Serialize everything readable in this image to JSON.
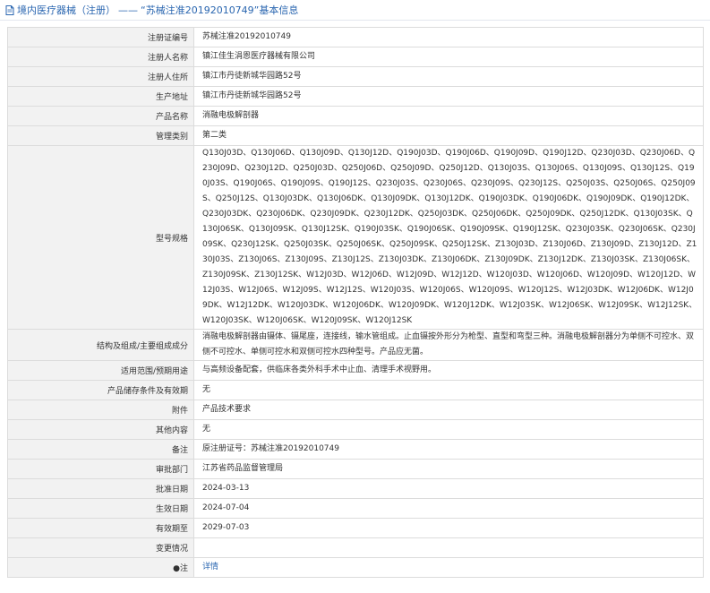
{
  "header": {
    "category": "境内医疗器械（注册）",
    "separator": "——",
    "rest": "“苏械注准20192010749”基本信息"
  },
  "rows": [
    {
      "label": "注册证编号",
      "value": "苏械注准20192010749"
    },
    {
      "label": "注册人名称",
      "value": "镇江佳生涓恩医疗器械有限公司"
    },
    {
      "label": "注册人住所",
      "value": "镇江市丹徒新城华园路52号"
    },
    {
      "label": "生产地址",
      "value": "镇江市丹徒新城华园路52号"
    },
    {
      "label": "产品名称",
      "value": "消融电极解剖器"
    },
    {
      "label": "管理类别",
      "value": "第二类"
    },
    {
      "label": "型号规格",
      "value": "Q130J03D、Q130J06D、Q130J09D、Q130J12D、Q190J03D、Q190J06D、Q190J09D、Q190J12D、Q230J03D、Q230J06D、Q230J09D、Q230J12D、Q250J03D、Q250J06D、Q250J09D、Q250J12D、Q130J03S、Q130J06S、Q130J09S、Q130J12S、Q190J03S、Q190J06S、Q190J09S、Q190J12S、Q230J03S、Q230J06S、Q230J09S、Q230J12S、Q250J03S、Q250J06S、Q250J09S、Q250J12S、Q130J03DK、Q130J06DK、Q130J09DK、Q130J12DK、Q190J03DK、Q190J06DK、Q190J09DK、Q190J12DK、Q230J03DK、Q230J06DK、Q230J09DK、Q230J12DK、Q250J03DK、Q250J06DK、Q250J09DK、Q250J12DK、Q130J03SK、Q130J06SK、Q130J09SK、Q130J12SK、Q190J03SK、Q190J06SK、Q190J09SK、Q190J12SK、Q230J03SK、Q230J06SK、Q230J09SK、Q230J12SK、Q250J03SK、Q250J06SK、Q250J09SK、Q250J12SK、Z130J03D、Z130J06D、Z130J09D、Z130J12D、Z130J03S、Z130J06S、Z130J09S、Z130J12S、Z130J03DK、Z130J06DK、Z130J09DK、Z130J12DK、Z130J03SK、Z130J06SK、Z130J09SK、Z130J12SK、W12J03D、W12J06D、W12J09D、W12J12D、W120J03D、W120J06D、W120J09D、W120J12D、W12J03S、W12J06S、W12J09S、W12J12S、W120J03S、W120J06S、W120J09S、W120J12S、W12J03DK、W12J06DK、W12J09DK、W12J12DK、W120J03DK、W120J06DK、W120J09DK、W120J12DK、W12J03SK、W12J06SK、W12J09SK、W12J12SK、W120J03SK、W120J06SK、W120J09SK、W120J12SK"
    },
    {
      "label": "结构及组成/主要组成成分",
      "value": "消融电极解剖器由镊体、镊尾座，连接线，输水管组成。止血镊按外形分为枪型、直型和弯型三种。消融电极解剖器分为单侧不可控水、双侧不可控水、单侧可控水和双侧可控水四种型号。产品应无菌。"
    },
    {
      "label": "适用范围/预期用途",
      "value": "与高频设备配套，供临床各类外科手术中止血、清理手术视野用。"
    },
    {
      "label": "产品储存条件及有效期",
      "value": "无"
    },
    {
      "label": "附件",
      "value": "产品技术要求"
    },
    {
      "label": "其他内容",
      "value": "无"
    },
    {
      "label": "备注",
      "value": "原注册证号：苏械注准20192010749"
    },
    {
      "label": "审批部门",
      "value": "江苏省药品监督管理局"
    },
    {
      "label": "批准日期",
      "value": "2024-03-13"
    },
    {
      "label": "生效日期",
      "value": "2024-07-04"
    },
    {
      "label": "有效期至",
      "value": "2029-07-03"
    },
    {
      "label": "变更情况",
      "value": ""
    },
    {
      "label": "●注",
      "value": "详情"
    }
  ]
}
